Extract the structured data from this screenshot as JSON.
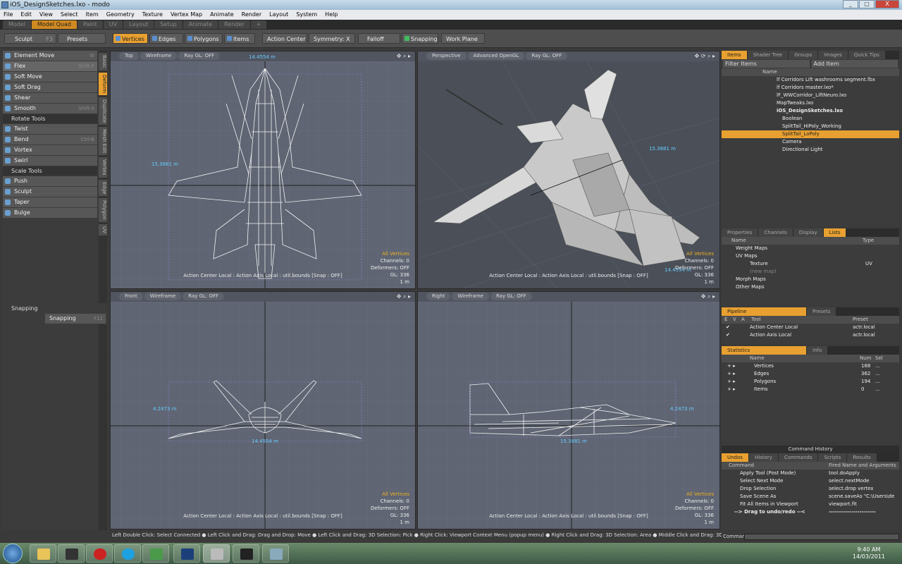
{
  "window": {
    "title": "iOS_DesignSketches.lxo - modo",
    "min": "_",
    "max": "□",
    "close": "X"
  },
  "menu": [
    "File",
    "Edit",
    "View",
    "Select",
    "Item",
    "Geometry",
    "Texture",
    "Vertex Map",
    "Animate",
    "Render",
    "Layout",
    "System",
    "Help"
  ],
  "layouts": [
    "Model",
    "Model Quad",
    "Paint",
    "UV",
    "Layout",
    "Setup",
    "Animate",
    "Render",
    "+"
  ],
  "toolbar": {
    "sculpt": "Sculpt",
    "sculpt_key": "F3",
    "presets": "Presets",
    "vertices": "Vertices",
    "edges": "Edges",
    "polygons": "Polygons",
    "items": "Items",
    "action_center": "Action Center",
    "symmetry": "Symmetry: X",
    "falloff": "Falloff",
    "snapping": "Snapping",
    "work_plane": "Work Plane"
  },
  "deform_tools": [
    {
      "label": "Element Move",
      "key": "W"
    },
    {
      "label": "Flex",
      "key": "Shift-F"
    },
    {
      "label": "Soft Move",
      "key": ""
    },
    {
      "label": "Soft Drag",
      "key": ""
    },
    {
      "label": "Shear",
      "key": ""
    },
    {
      "label": "Smooth",
      "key": "Shift-S"
    }
  ],
  "rotate_header": "Rotate Tools",
  "rotate_tools": [
    {
      "label": "Twist",
      "key": ""
    },
    {
      "label": "Bend",
      "key": "Ctrl-B"
    },
    {
      "label": "Vortex",
      "key": ""
    },
    {
      "label": "Swirl",
      "key": ""
    }
  ],
  "scale_header": "Scale Tools",
  "scale_tools": [
    {
      "label": "Push",
      "key": ""
    },
    {
      "label": "Sculpt",
      "key": ""
    },
    {
      "label": "Taper",
      "key": ""
    },
    {
      "label": "Bulge",
      "key": ""
    }
  ],
  "vtabs": [
    "Basic",
    "Deform",
    "Duplicate",
    "Mesh Edit",
    "Vertex",
    "Edge",
    "Polygon",
    "UV"
  ],
  "snapping_panel": {
    "title": "Snapping",
    "button": "Snapping",
    "key": "F11"
  },
  "viewports": [
    {
      "view": "Top",
      "shading": "Wireframe",
      "raygl": "Ray GL: OFF",
      "dim_w": "14.4554 m",
      "dim_h": "15.3881 m",
      "status": "Action Center Local : Action Axis Local : util.bounds  [Snap : OFF]",
      "info": [
        "All Vertices",
        "Channels: 0",
        "Deformers: OFF",
        "GL: 336",
        "1 m"
      ]
    },
    {
      "view": "Perspective",
      "shading": "Advanced OpenGL",
      "raygl": "Ray GL: OFF",
      "dim_w": "14.4554 m",
      "dim_h": "15.3881 m",
      "status": "Action Center Local : Action Axis Local : util.bounds  [Snap : OFF]",
      "info": [
        "All Vertices",
        "Channels: 0",
        "Deformers: OFF",
        "GL: 336",
        "1 m"
      ]
    },
    {
      "view": "Front",
      "shading": "Wireframe",
      "raygl": "Ray GL: OFF",
      "dim_w": "14.4554 m",
      "dim_h": "4.2473 m",
      "status": "Action Center Local : Action Axis Local : util.bounds  [Snap : OFF]",
      "info": [
        "All Vertices",
        "Channels: 0",
        "Deformers: OFF",
        "GL: 336",
        "1 m"
      ]
    },
    {
      "view": "Right",
      "shading": "Wireframe",
      "raygl": "Ray GL: OFF",
      "dim_w": "15.3881 m",
      "dim_h": "4.2473 m",
      "status": "Action Center Local : Action Axis Local : util.bounds  [Snap : OFF]",
      "info": [
        "All Vertices",
        "Channels: 0",
        "Deformers: OFF",
        "GL: 336",
        "1 m"
      ]
    }
  ],
  "items_panel": {
    "tabs": [
      "Items",
      "Shader Tree",
      "Groups",
      "Images",
      "Quick Tips"
    ],
    "filter": "Filter Items",
    "add": "Add Item",
    "name_hdr": "Name",
    "rows": [
      "lf Corridors Lift washrooms segment.fbx",
      "lf Corridors master.lxo*",
      "lF_WWCorridor_LiftNeuro.lxo",
      "MapTweaks.lxo",
      "iOS_DesignSketches.lxo",
      "Boolean",
      "SplitTail_HiPoly_Working",
      "SplitTail_LoPoly",
      "Camera",
      "Directional Light"
    ]
  },
  "lists_panel": {
    "tabs": [
      "Properties",
      "Channels",
      "Display",
      "Lists"
    ],
    "name_hdr": "Name",
    "type_hdr": "Type",
    "rows": [
      {
        "name": "Weight Maps",
        "type": ""
      },
      {
        "name": "UV Maps",
        "type": ""
      },
      {
        "name": "Texture",
        "type": "UV"
      },
      {
        "name": "(new map)",
        "type": ""
      },
      {
        "name": "Morph Maps",
        "type": ""
      },
      {
        "name": "Other Maps",
        "type": ""
      }
    ]
  },
  "pipeline": {
    "tabs": [
      "Pipeline",
      "Presets"
    ],
    "hdr": [
      "E",
      "V",
      "A",
      "Tool",
      "Preset"
    ],
    "rows": [
      {
        "tool": "Action Center Local",
        "preset": "actr.local"
      },
      {
        "tool": "Action Axis Local",
        "preset": "actr.local"
      }
    ]
  },
  "statistics": {
    "tabs": [
      "Statistics",
      "Info"
    ],
    "hdr": [
      "Name",
      "Num",
      "Sel"
    ],
    "rows": [
      {
        "name": "Vertices",
        "num": "168",
        "sel": "..."
      },
      {
        "name": "Edges",
        "num": "362",
        "sel": "..."
      },
      {
        "name": "Polygons",
        "num": "194",
        "sel": "..."
      },
      {
        "name": "Items",
        "num": "0",
        "sel": "..."
      }
    ]
  },
  "command_history": {
    "title": "Command History",
    "tabs": [
      "Undos",
      "History",
      "Commands",
      "Scripts",
      "Results"
    ],
    "hdr": [
      "Command",
      "Fired Name and Arguments"
    ],
    "rows": [
      {
        "cmd": "Apply Tool (Post Mode)",
        "args": "tool.doApply"
      },
      {
        "cmd": "Select Next Mode",
        "args": "select.nextMode"
      },
      {
        "cmd": "Drop Selection",
        "args": "select.drop vertex"
      },
      {
        "cmd": "Save Scene As",
        "args": "scene.saveAs \"C:\\Users\\de"
      },
      {
        "cmd": "Fit All Items in Viewport",
        "args": "viewport.fit"
      },
      {
        "cmd": "--> Drag to undo/redo --<",
        "args": "-----------------------"
      }
    ]
  },
  "statusline": "Left Double Click: Select Connected ● Left Click and Drag: Drag and Drop: Move ● Left Click and Drag: 3D Selection: Pick ● Right Click: Viewport Context Menu (popup menu) ● Right Click and Drag: 3D Selection: Area ● Middle Click and Drag: 3D Selection: Pick Thr...",
  "command_label": "Command",
  "clock": {
    "time": "9:40 AM",
    "date": "14/03/2011"
  }
}
